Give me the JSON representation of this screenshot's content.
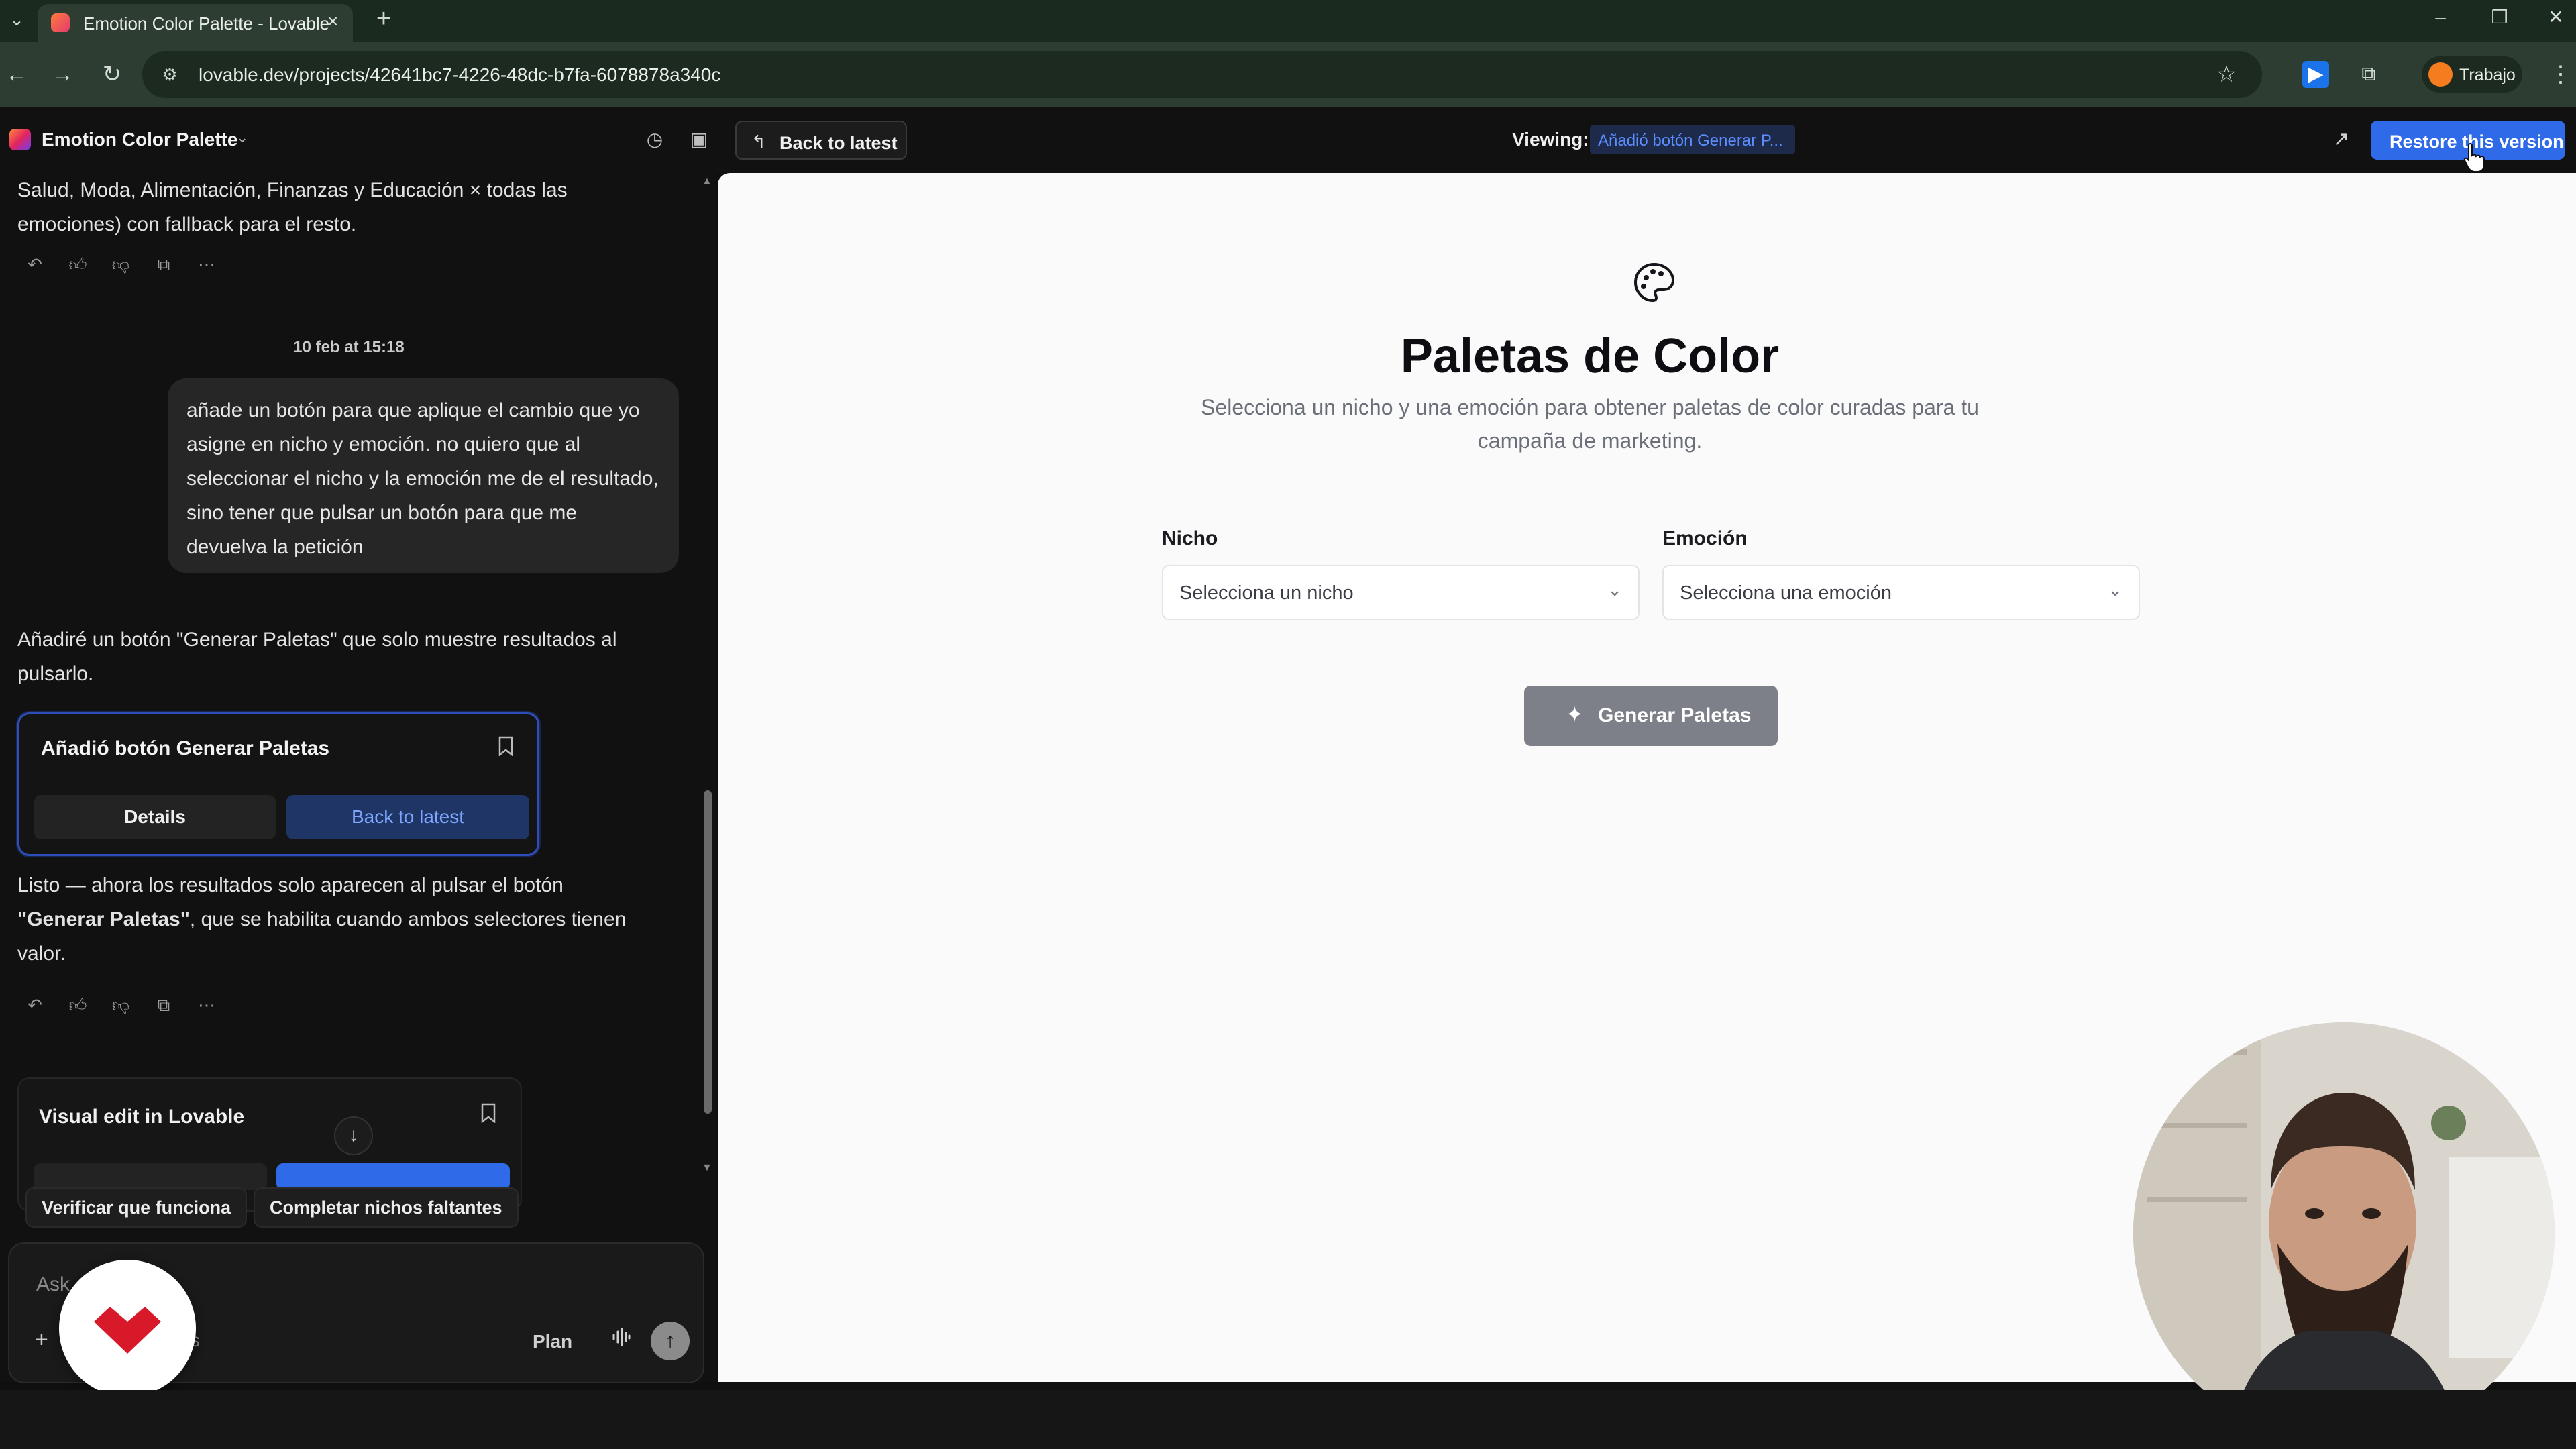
{
  "browser": {
    "tab_title": "Emotion Color Palette - Lovable",
    "url": "lovable.dev/projects/42641bc7-4226-48dc-b7fa-6078878a340c",
    "profile_name": "Trabajo"
  },
  "header": {
    "project_name": "Emotion Color Palette",
    "back_to_latest": "Back to latest",
    "viewing_label": "Viewing:",
    "viewing_version": "Añadió botón Generar P...",
    "restore_button": "Restore this version"
  },
  "chat": {
    "message_top": "Salud, Moda, Alimentación, Finanzas y Educación × todas las emociones) con fallback para el resto.",
    "message_top_line1": "Salud, Moda, Alimentación, Finanzas y Educación × todas las",
    "message_top_line2": "emociones) con fallback para el resto.",
    "timestamp": "10 feb at 15:18",
    "user_message": "añade un botón para que aplique el cambio que yo asigne en nicho y emoción. no quiero que al seleccionar el nicho y la emoción me de el resultado, sino tener que pulsar un botón para que me devuelva la petición",
    "ai_reply_line1": "Añadiré un botón \"Generar Paletas\" que solo muestre resultados al",
    "ai_reply_line2": "pulsarlo.",
    "version_card": {
      "title": "Añadió botón Generar Paletas",
      "details": "Details",
      "back_to_latest": "Back to latest"
    },
    "done_line1": "Listo — ahora los resultados solo aparecen al pulsar el botón",
    "done_bold": "\"Generar Paletas\"",
    "done_line2_rest": ", que se habilita cuando ambos selectores tienen",
    "done_line3": "valor.",
    "visual_card": {
      "title": "Visual edit in Lovable"
    },
    "suggestions": [
      "Verificar que funciona",
      "Completar nichos faltantes"
    ],
    "composer": {
      "placeholder": "Ask",
      "s_fragment": "s",
      "plan": "Plan"
    }
  },
  "preview": {
    "title": "Paletas de Color",
    "subtitle": "Selecciona un nicho y una emoción para obtener paletas de color curadas para tu campaña de marketing.",
    "niche_label": "Nicho",
    "niche_placeholder": "Selecciona un nicho",
    "emotion_label": "Emoción",
    "emotion_placeholder": "Selecciona una emoción",
    "generate_button": "Generar Paletas"
  },
  "colors": {
    "accent_blue": "#2f6ae8",
    "brand_red": "#d7192a",
    "generate_button_disabled": "#7d8088"
  }
}
